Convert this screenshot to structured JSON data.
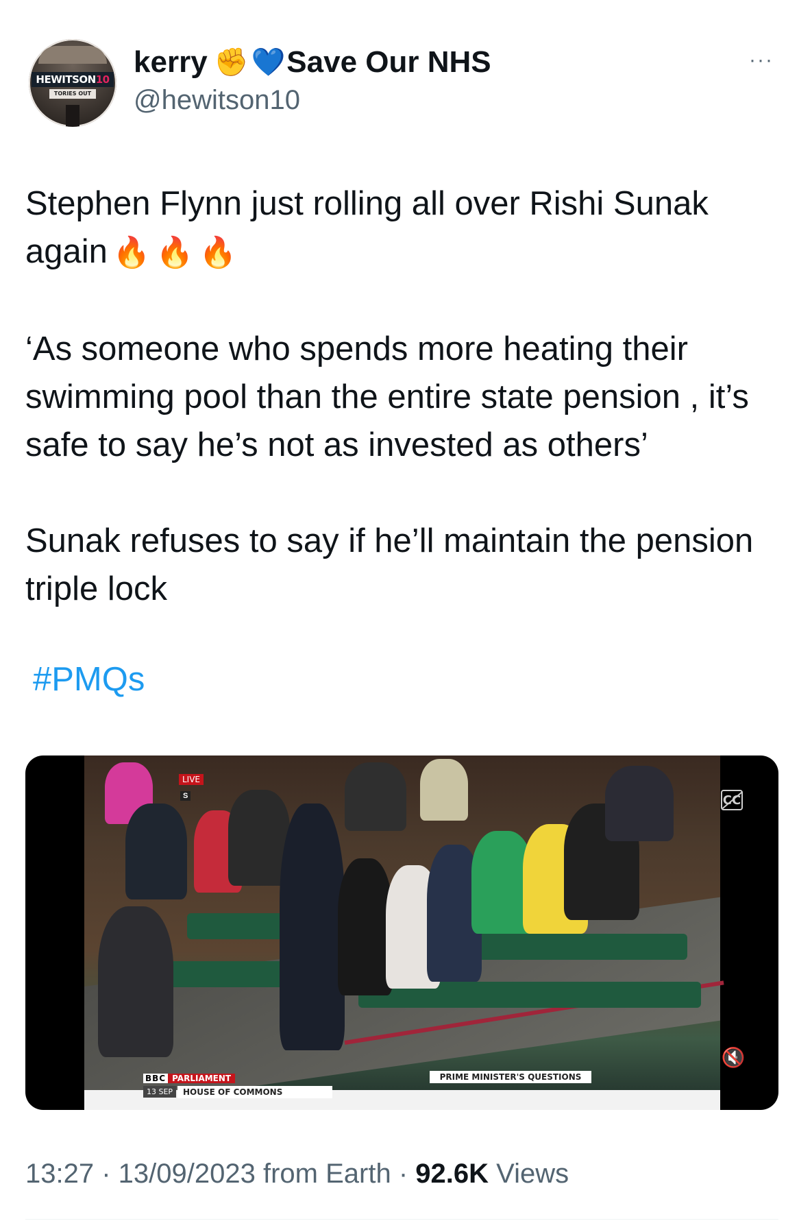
{
  "author": {
    "display_name": "kerry",
    "display_suffix": "Save Our NHS",
    "handle": "@hewitson10",
    "avatar_sign": "HEWITSON",
    "avatar_sign_num": "10",
    "avatar_sub": "TORIES OUT"
  },
  "icons": {
    "fist": "✊",
    "heart": "💙",
    "fire": "🔥",
    "more": "···",
    "mute": "🔇"
  },
  "tweet": {
    "paragraph1": "Stephen Flynn just rolling all over Rishi Sunak again",
    "paragraph2": "‘As someone who spends more heating their swimming pool than the entire state pension , it’s safe to say he’s not as invested as others’",
    "paragraph3": "Sunak refuses to say if he’ll maintain the pension triple lock",
    "hashtag": "#PMQs"
  },
  "media": {
    "live_label": "LIVE",
    "channel_logo": "BBC",
    "channel_name": "PARLIAMENT",
    "date_label": "13 SEP",
    "location_label": "HOUSE OF COMMONS",
    "program_label": "PRIME MINISTER'S QUESTIONS"
  },
  "footer": {
    "time": "13:27",
    "date": "13/09/2023",
    "source": "from Earth",
    "views_count": "92.6K",
    "views_label": "Views"
  },
  "colors": {
    "link": "#1d9bf0",
    "secondary_text": "#536471",
    "primary_text": "#0f1419"
  }
}
